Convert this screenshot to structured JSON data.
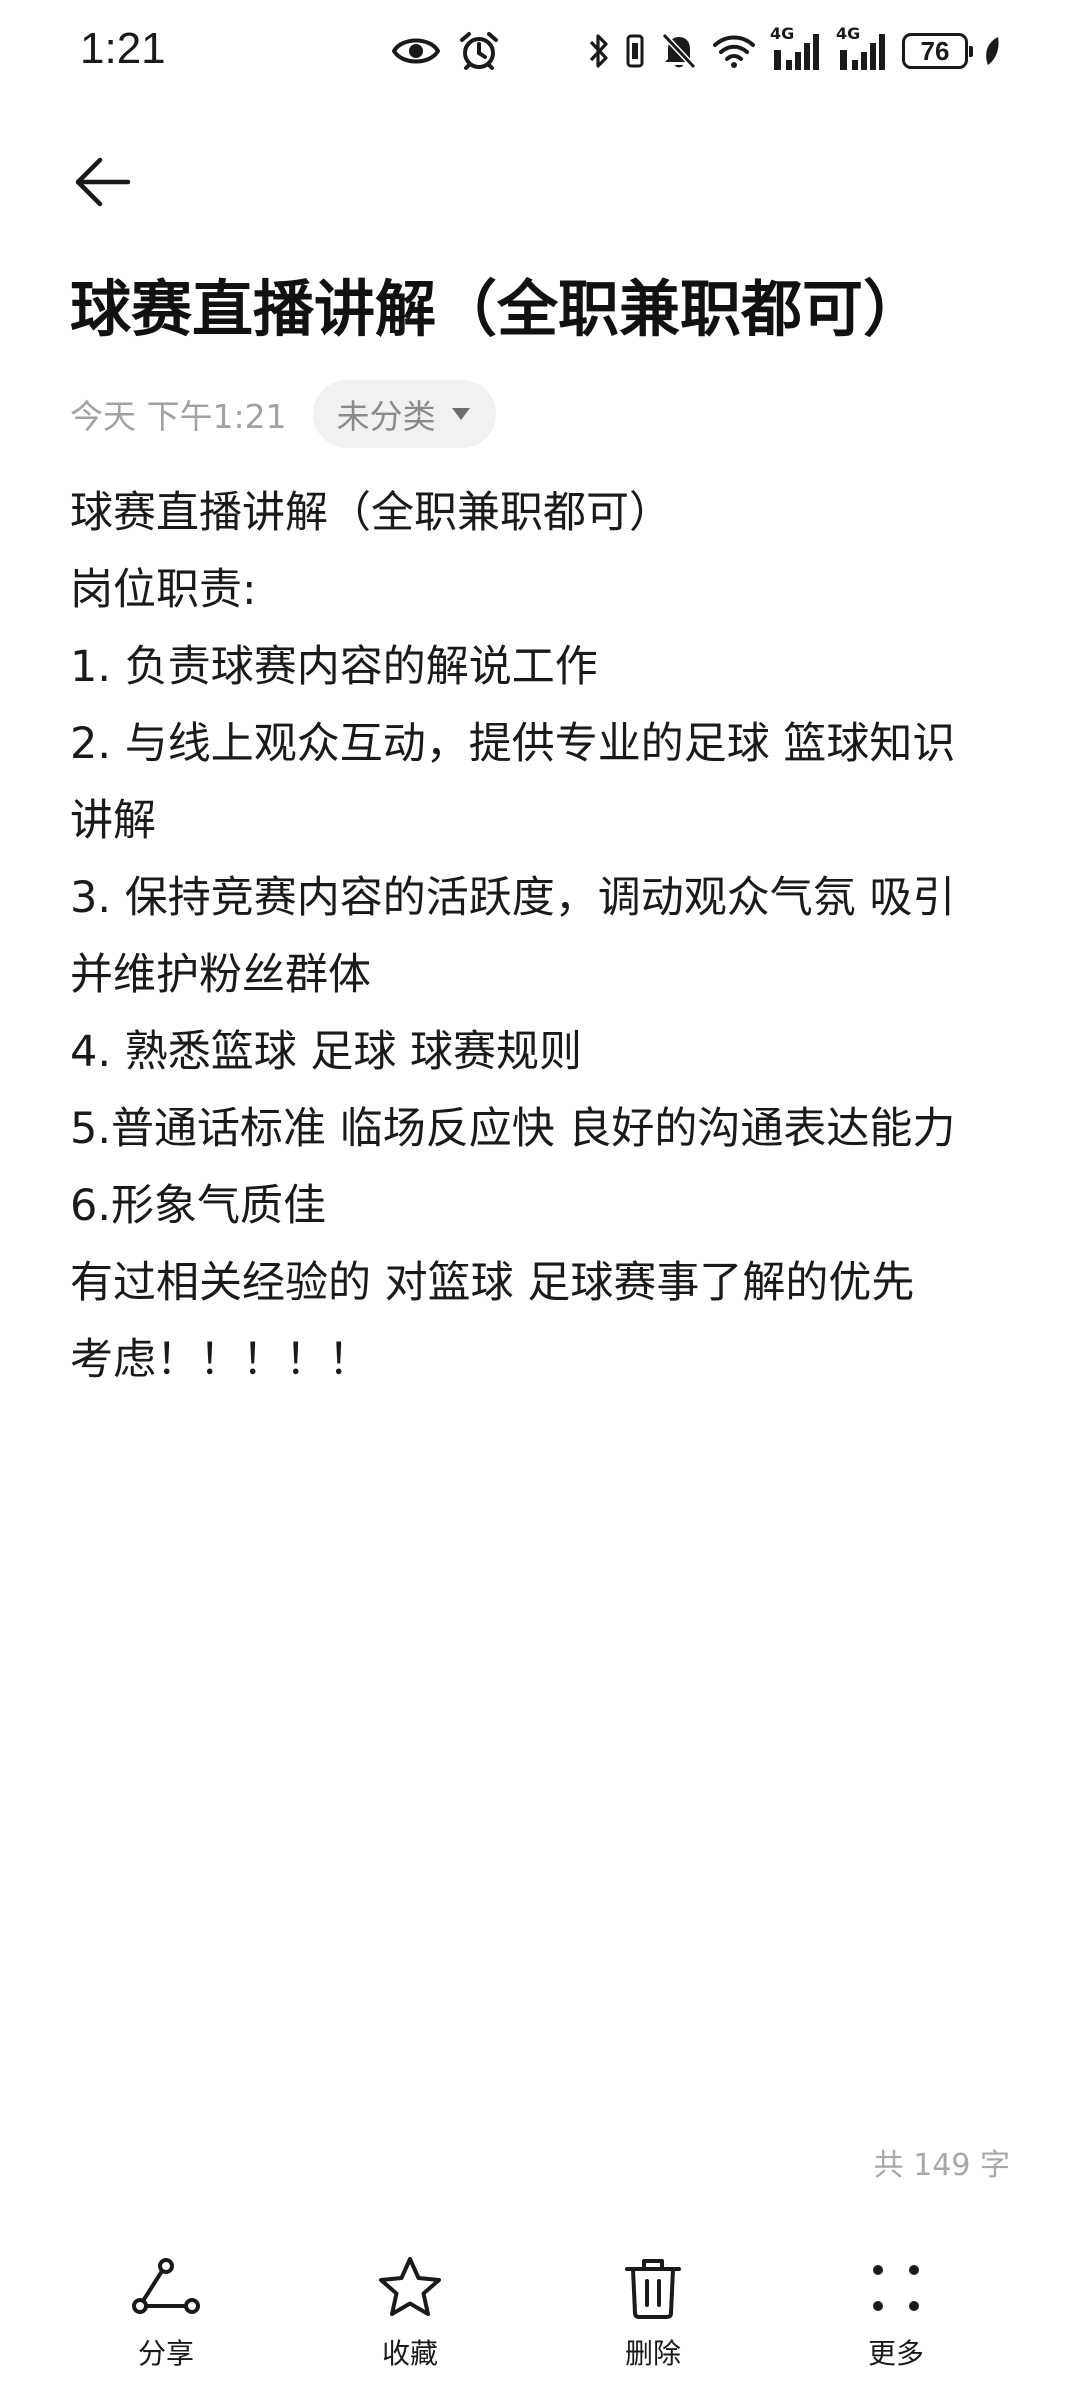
{
  "status_bar": {
    "time": "1:21",
    "network_1": "4G",
    "network_2": "4G",
    "battery": "76",
    "icons": [
      "eye-icon",
      "alarm-icon",
      "bluetooth-icon",
      "vibrate-icon",
      "mute-icon",
      "wifi-icon",
      "signal-icon",
      "signal-icon",
      "battery-icon",
      "leaf-icon"
    ]
  },
  "header": {
    "back_icon": "back-arrow-icon"
  },
  "note": {
    "title": "球赛直播讲解（全职兼职都可）",
    "date": "今天 下午1:21",
    "category": "未分类",
    "body_lines": [
      "球赛直播讲解（全职兼职都可）",
      "岗位职责:",
      "1. 负责球赛内容的解说工作",
      "2. 与线上观众互动，提供专业的足球 篮球知识",
      "讲解",
      "3. 保持竞赛内容的活跃度，调动观众气氛 吸引",
      "并维护粉丝群体",
      "4. 熟悉篮球 足球 球赛规则",
      "5.普通话标准 临场反应快 良好的沟通表达能力",
      "6.形象气质佳",
      "有过相关经验的 对篮球 足球赛事了解的优先",
      "考虑！！！！！"
    ],
    "word_count": "共 149 字"
  },
  "toolbar": {
    "share_label": "分享",
    "favorite_label": "收藏",
    "delete_label": "删除",
    "more_label": "更多"
  }
}
